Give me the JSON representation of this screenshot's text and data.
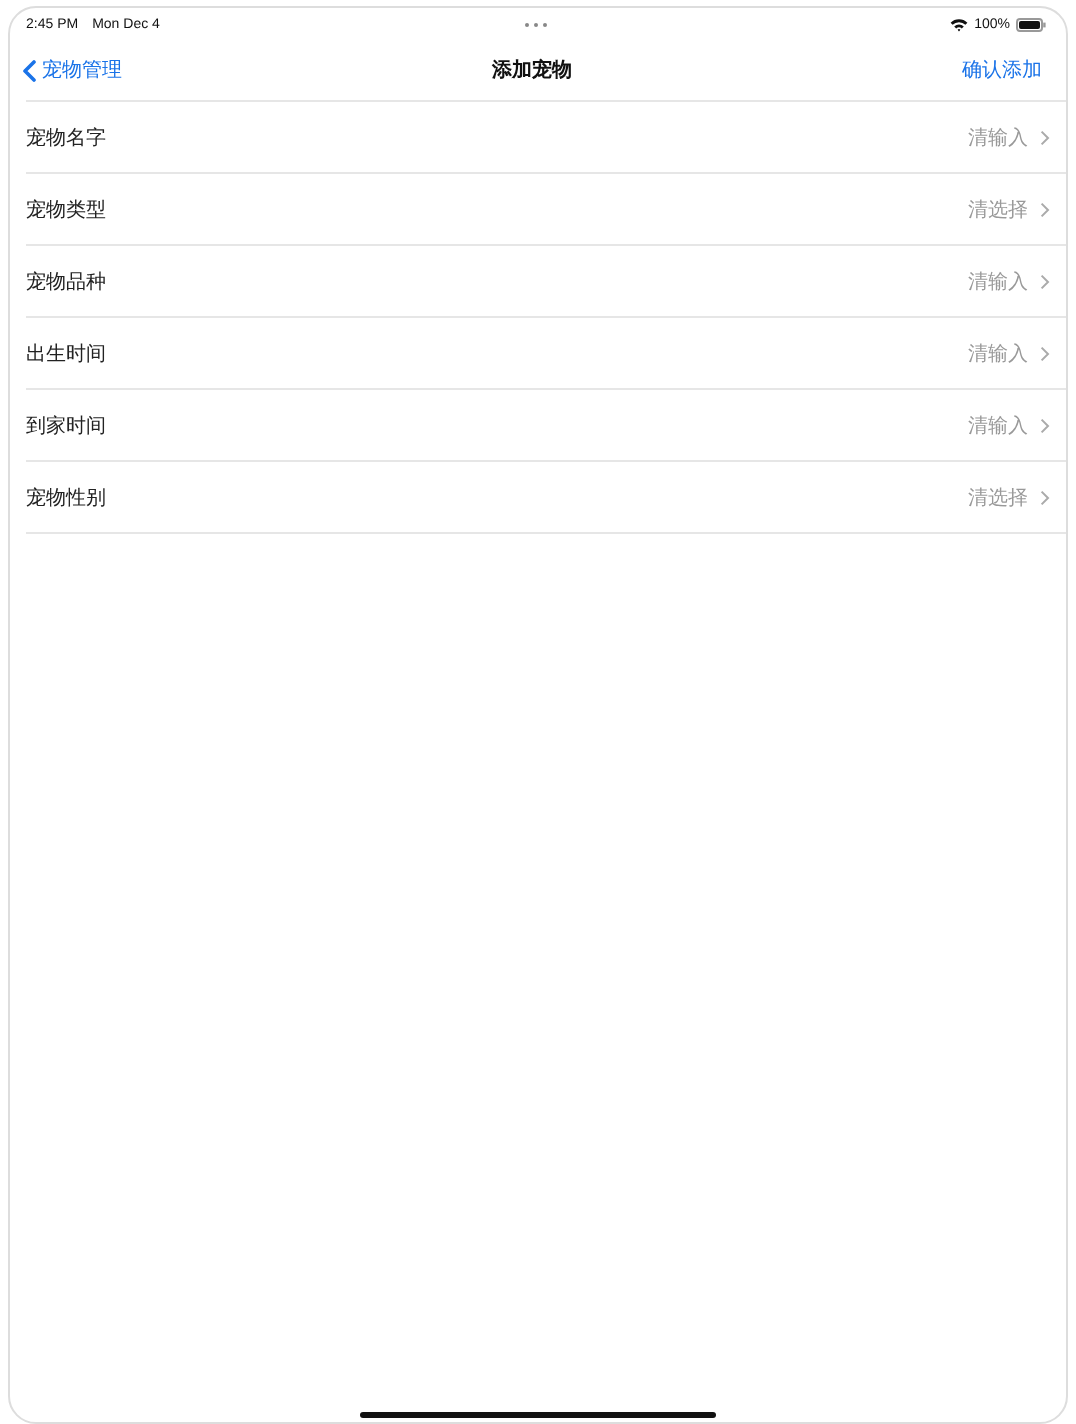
{
  "status_bar": {
    "time": "2:45 PM",
    "date": "Mon Dec 4",
    "battery": "100%"
  },
  "nav_bar": {
    "back": "宠物管理",
    "title": "添加宠物",
    "action": "确认添加"
  },
  "rows": [
    {
      "label": "宠物名字",
      "placeholder": "清输入"
    },
    {
      "label": "宠物类型",
      "placeholder": "清选择"
    },
    {
      "label": "宠物品种",
      "placeholder": "清输入"
    },
    {
      "label": "出生时间",
      "placeholder": "清输入"
    },
    {
      "label": "到家时间",
      "placeholder": "清输入"
    },
    {
      "label": "宠物性别",
      "placeholder": "清选择"
    }
  ]
}
